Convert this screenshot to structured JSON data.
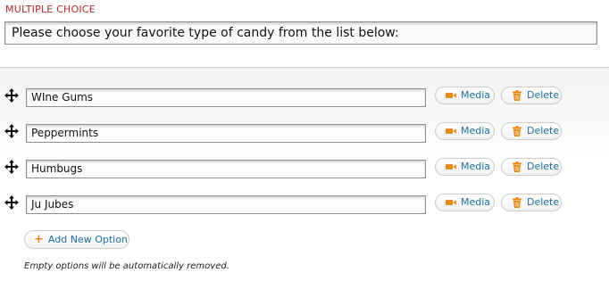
{
  "section": {
    "title": "MULTIPLE CHOICE"
  },
  "question": {
    "text": "Please choose your favorite type of candy from the list below:"
  },
  "options": [
    {
      "value": "WIne Gums",
      "media_label": "Media",
      "delete_label": "Delete"
    },
    {
      "value": "Peppermints",
      "media_label": "Media",
      "delete_label": "Delete"
    },
    {
      "value": "Humbugs",
      "media_label": "Media",
      "delete_label": "Delete"
    },
    {
      "value": "Ju Jubes",
      "media_label": "Media",
      "delete_label": "Delete"
    }
  ],
  "add_option": {
    "label": "Add New Option",
    "icon": "plus-icon"
  },
  "hint": "Empty options will be automatically removed.",
  "icons": {
    "drag": "move-arrows-icon",
    "media": "video-camera-icon",
    "delete": "trash-icon"
  },
  "colors": {
    "title": "#b8262b",
    "link": "#1f6fa3",
    "icon_accent": "#e58b1b"
  }
}
